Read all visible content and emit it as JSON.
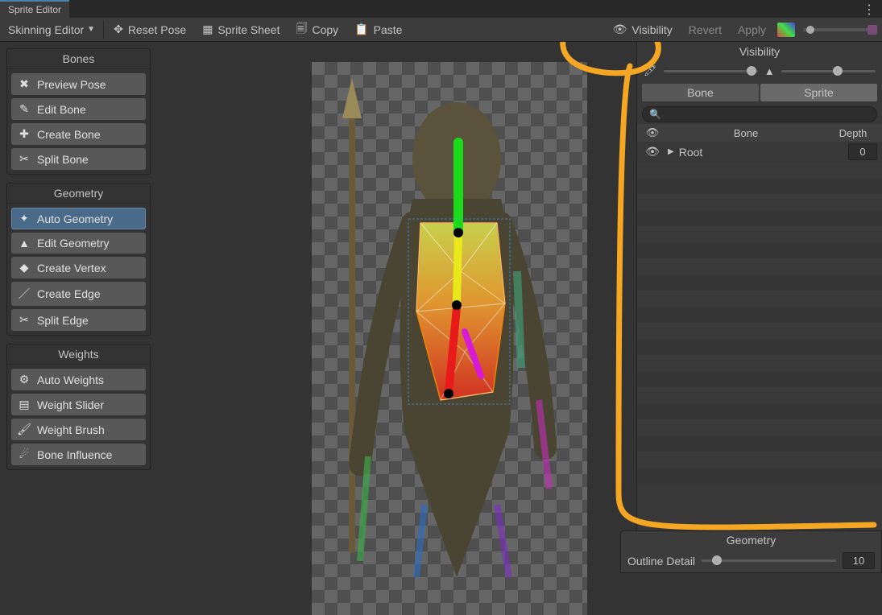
{
  "window": {
    "tab_title": "Sprite Editor"
  },
  "toolbar": {
    "mode_label": "Skinning Editor",
    "reset_pose": "Reset Pose",
    "sprite_sheet": "Sprite Sheet",
    "copy": "Copy",
    "paste": "Paste",
    "visibility": "Visibility",
    "revert": "Revert",
    "apply": "Apply"
  },
  "left": {
    "bones": {
      "title": "Bones",
      "preview_pose": "Preview Pose",
      "edit_bone": "Edit Bone",
      "create_bone": "Create Bone",
      "split_bone": "Split Bone"
    },
    "geometry": {
      "title": "Geometry",
      "auto_geometry": "Auto Geometry",
      "edit_geometry": "Edit Geometry",
      "create_vertex": "Create Vertex",
      "create_edge": "Create Edge",
      "split_edge": "Split Edge"
    },
    "weights": {
      "title": "Weights",
      "auto_weights": "Auto Weights",
      "weight_slider": "Weight Slider",
      "weight_brush": "Weight Brush",
      "bone_influence": "Bone Influence"
    }
  },
  "right": {
    "title": "Visibility",
    "tabs": {
      "bone": "Bone",
      "sprite": "Sprite"
    },
    "search_placeholder": "",
    "columns": {
      "eye": "",
      "bone": "Bone",
      "depth": "Depth"
    },
    "rows": [
      {
        "name": "Root",
        "depth": "0"
      }
    ]
  },
  "geometry_panel": {
    "title": "Geometry",
    "outline_detail_label": "Outline Detail",
    "outline_detail_value": "10"
  }
}
